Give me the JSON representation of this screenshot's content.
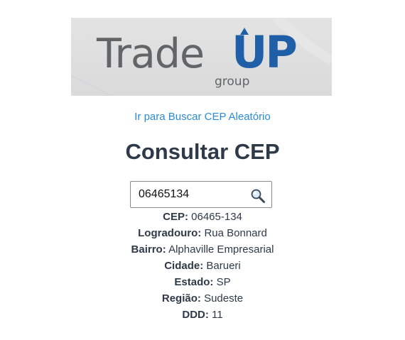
{
  "logo": {
    "word_trade": "Trade",
    "word_up": "UP",
    "word_group": "group",
    "colors": {
      "text_gray": "#636466",
      "brand_blue": "#1f5fa8",
      "banner_bg": "#dedede"
    }
  },
  "nav": {
    "random_link_label": "Ir para Buscar CEP Aleatório",
    "link_color": "#2a8bd4"
  },
  "main": {
    "title": "Consultar CEP",
    "search": {
      "value": "06465134",
      "icon": "magnifier-icon"
    },
    "results": [
      {
        "label": "CEP:",
        "value": "06465-134"
      },
      {
        "label": "Logradouro:",
        "value": "Rua Bonnard"
      },
      {
        "label": "Bairro:",
        "value": "Alphaville Empresarial"
      },
      {
        "label": "Cidade:",
        "value": "Barueri"
      },
      {
        "label": "Estado:",
        "value": "SP"
      },
      {
        "label": "Região:",
        "value": "Sudeste"
      },
      {
        "label": "DDD:",
        "value": "11"
      }
    ]
  }
}
